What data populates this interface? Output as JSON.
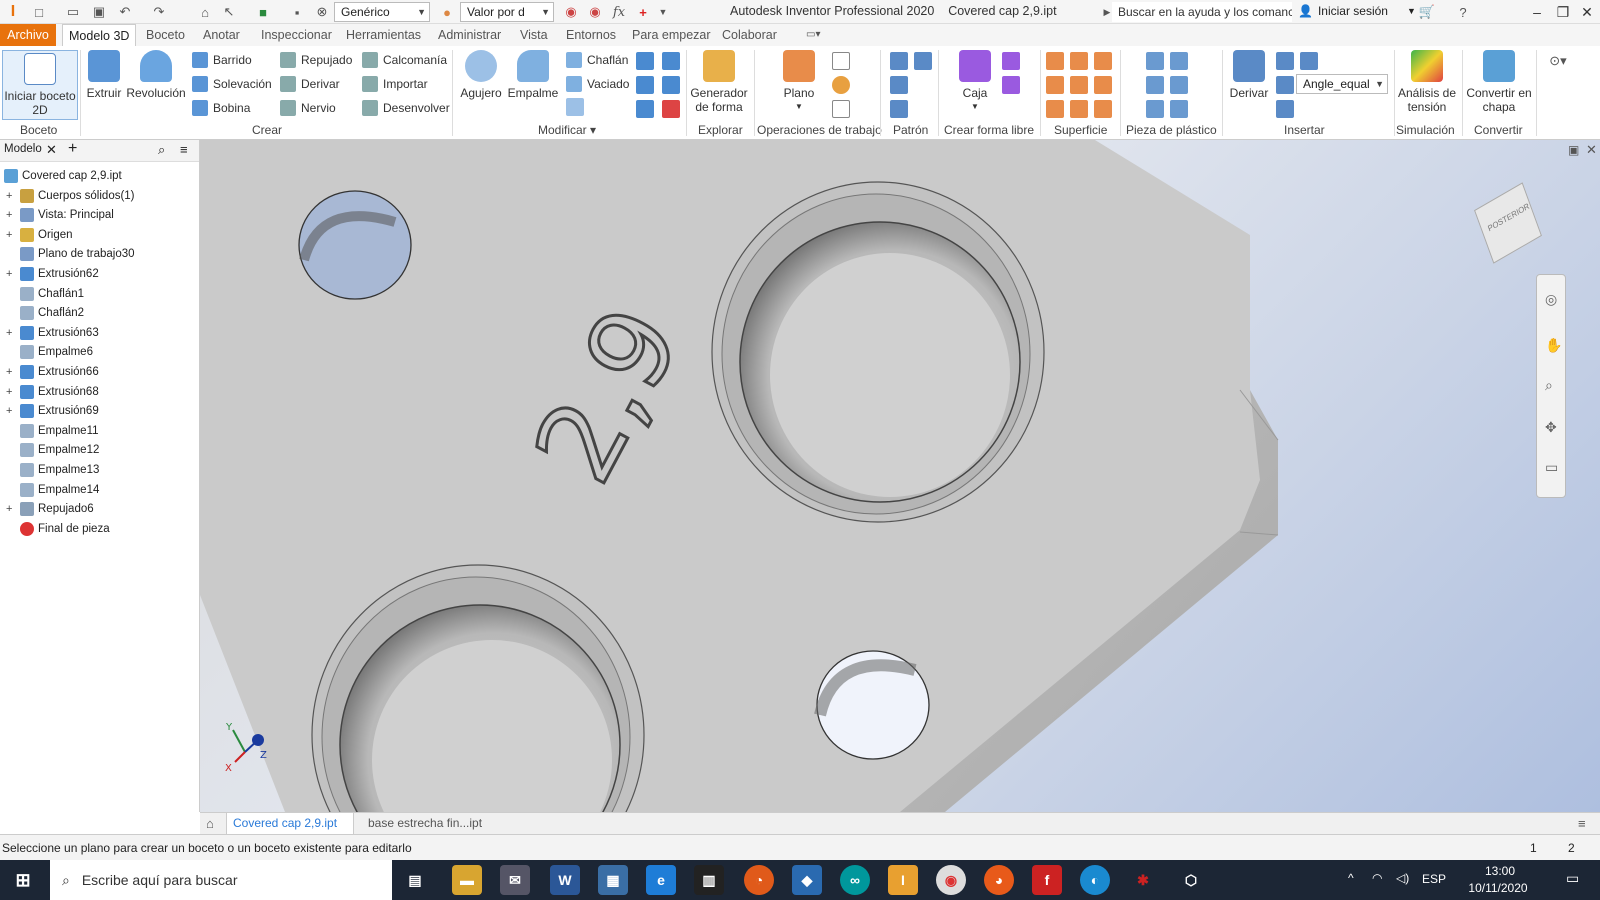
{
  "quick_access": {
    "appearance_combo": "Genérico",
    "value_combo": "Valor por d",
    "window_title": "Autodesk Inventor Professional 2020",
    "document_title": "Covered cap 2,9.ipt",
    "help_search": "Buscar en la ayuda y los comanc",
    "sign_in": "Iniciar sesión"
  },
  "menu_tabs": [
    "Archivo",
    "Modelo 3D",
    "Boceto",
    "Anotar",
    "Inspeccionar",
    "Herramientas",
    "Administrar",
    "Vista",
    "Entornos",
    "Para empezar",
    "Colaborar"
  ],
  "active_tab": "Modelo 3D",
  "ribbon": {
    "start_sketch": "Iniciar boceto 2D",
    "extrude": "Extruir",
    "revolve": "Revolución",
    "sweep": "Barrido",
    "loft": "Solevación",
    "coil": "Bobina",
    "emboss": "Repujado",
    "derive": "Derivar",
    "rib": "Nervio",
    "decal": "Calcomanía",
    "import": "Importar",
    "unwrap": "Desenvolver",
    "hole": "Agujero",
    "fillet": "Empalme",
    "chamfer": "Chaflán",
    "shell": "Vaciado",
    "shape_generator": "Generador de forma",
    "plane": "Plano",
    "box": "Caja",
    "derive_insert": "Derivar",
    "angle_equal": "Angle_equal",
    "stress_analysis": "Análisis de tensión",
    "convert_sheet": "Convertir en chapa",
    "groups": {
      "sketch": "Boceto",
      "create": "Crear",
      "modify": "Modificar",
      "explore": "Explorar",
      "work_features": "Operaciones de trabajo",
      "pattern": "Patrón",
      "freeform": "Crear forma libre",
      "surface": "Superficie",
      "plastic": "Pieza de plástico",
      "insert": "Insertar",
      "simulation": "Simulación",
      "convert": "Convertir"
    }
  },
  "browser": {
    "tab_label": "Modelo",
    "items": [
      {
        "label": "Covered cap 2,9.ipt",
        "expandable": false
      },
      {
        "label": "Cuerpos sólidos(1)",
        "expandable": true
      },
      {
        "label": "Vista: Principal",
        "expandable": true
      },
      {
        "label": "Origen",
        "expandable": true
      },
      {
        "label": "Plano de trabajo30",
        "expandable": false
      },
      {
        "label": "Extrusión62",
        "expandable": true
      },
      {
        "label": "Chaflán1",
        "expandable": false
      },
      {
        "label": "Chaflán2",
        "expandable": false
      },
      {
        "label": "Extrusión63",
        "expandable": true
      },
      {
        "label": "Empalme6",
        "expandable": false
      },
      {
        "label": "Extrusión66",
        "expandable": true
      },
      {
        "label": "Extrusión68",
        "expandable": true
      },
      {
        "label": "Extrusión69",
        "expandable": true
      },
      {
        "label": "Empalme11",
        "expandable": false
      },
      {
        "label": "Empalme12",
        "expandable": false
      },
      {
        "label": "Empalme13",
        "expandable": false
      },
      {
        "label": "Empalme14",
        "expandable": false
      },
      {
        "label": "Repujado6",
        "expandable": true
      },
      {
        "label": "Final de pieza",
        "expandable": false
      }
    ]
  },
  "viewport": {
    "emboss_text": "2,9",
    "viewcube_label": "POSTERIOR"
  },
  "doc_tabs": [
    "Covered cap 2,9.ipt",
    "base estrecha fin...ipt"
  ],
  "status": {
    "message": "Seleccione un plano para crear un boceto o un boceto existente para editarlo",
    "count1": "1",
    "count2": "2"
  },
  "taskbar": {
    "search_placeholder": "Escribe aquí para buscar",
    "language": "ESP",
    "time": "13:00",
    "date": "10/11/2020"
  }
}
